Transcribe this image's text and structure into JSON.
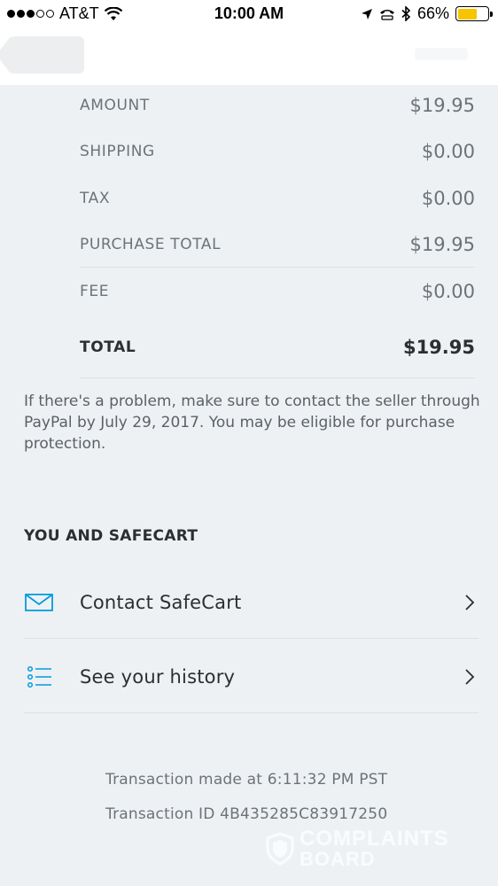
{
  "status_bar": {
    "carrier": "AT&T",
    "time": "10:00 AM",
    "battery": "66%",
    "battery_level": 0.66,
    "signal_bars_filled": 3,
    "signal_bars_total": 5,
    "icons": [
      "wifi-icon",
      "location-icon",
      "tty-icon",
      "bluetooth-icon",
      "battery-icon"
    ]
  },
  "summary": {
    "amount_label": "AMOUNT",
    "amount_value": "$19.95",
    "shipping_label": "SHIPPING",
    "shipping_value": "$0.00",
    "tax_label": "TAX",
    "tax_value": "$0.00",
    "purchase_total_label": "PURCHASE TOTAL",
    "purchase_total_value": "$19.95",
    "fee_label": "FEE",
    "fee_value": "$0.00",
    "total_label": "TOTAL",
    "total_value": "$19.95"
  },
  "notice": "If there's a problem, make sure to contact the seller through PayPal by July 29, 2017. You may be eligible for purchase protection.",
  "merchant_section": {
    "heading": "YOU AND SAFECART",
    "actions": [
      {
        "label": "Contact SafeCart",
        "icon": "mail-icon"
      },
      {
        "label": "See your history",
        "icon": "list-icon"
      }
    ]
  },
  "footer": {
    "time_line": "Transaction made at 6:11:32 PM PST",
    "id_line": "Transaction ID 4B435285C83917250"
  },
  "watermark": {
    "line1": "COMPLAINTS",
    "line2": "BOARD"
  },
  "colors": {
    "background": "#eef1f4",
    "accent_icon": "#009cde",
    "battery": "#f7c500"
  }
}
